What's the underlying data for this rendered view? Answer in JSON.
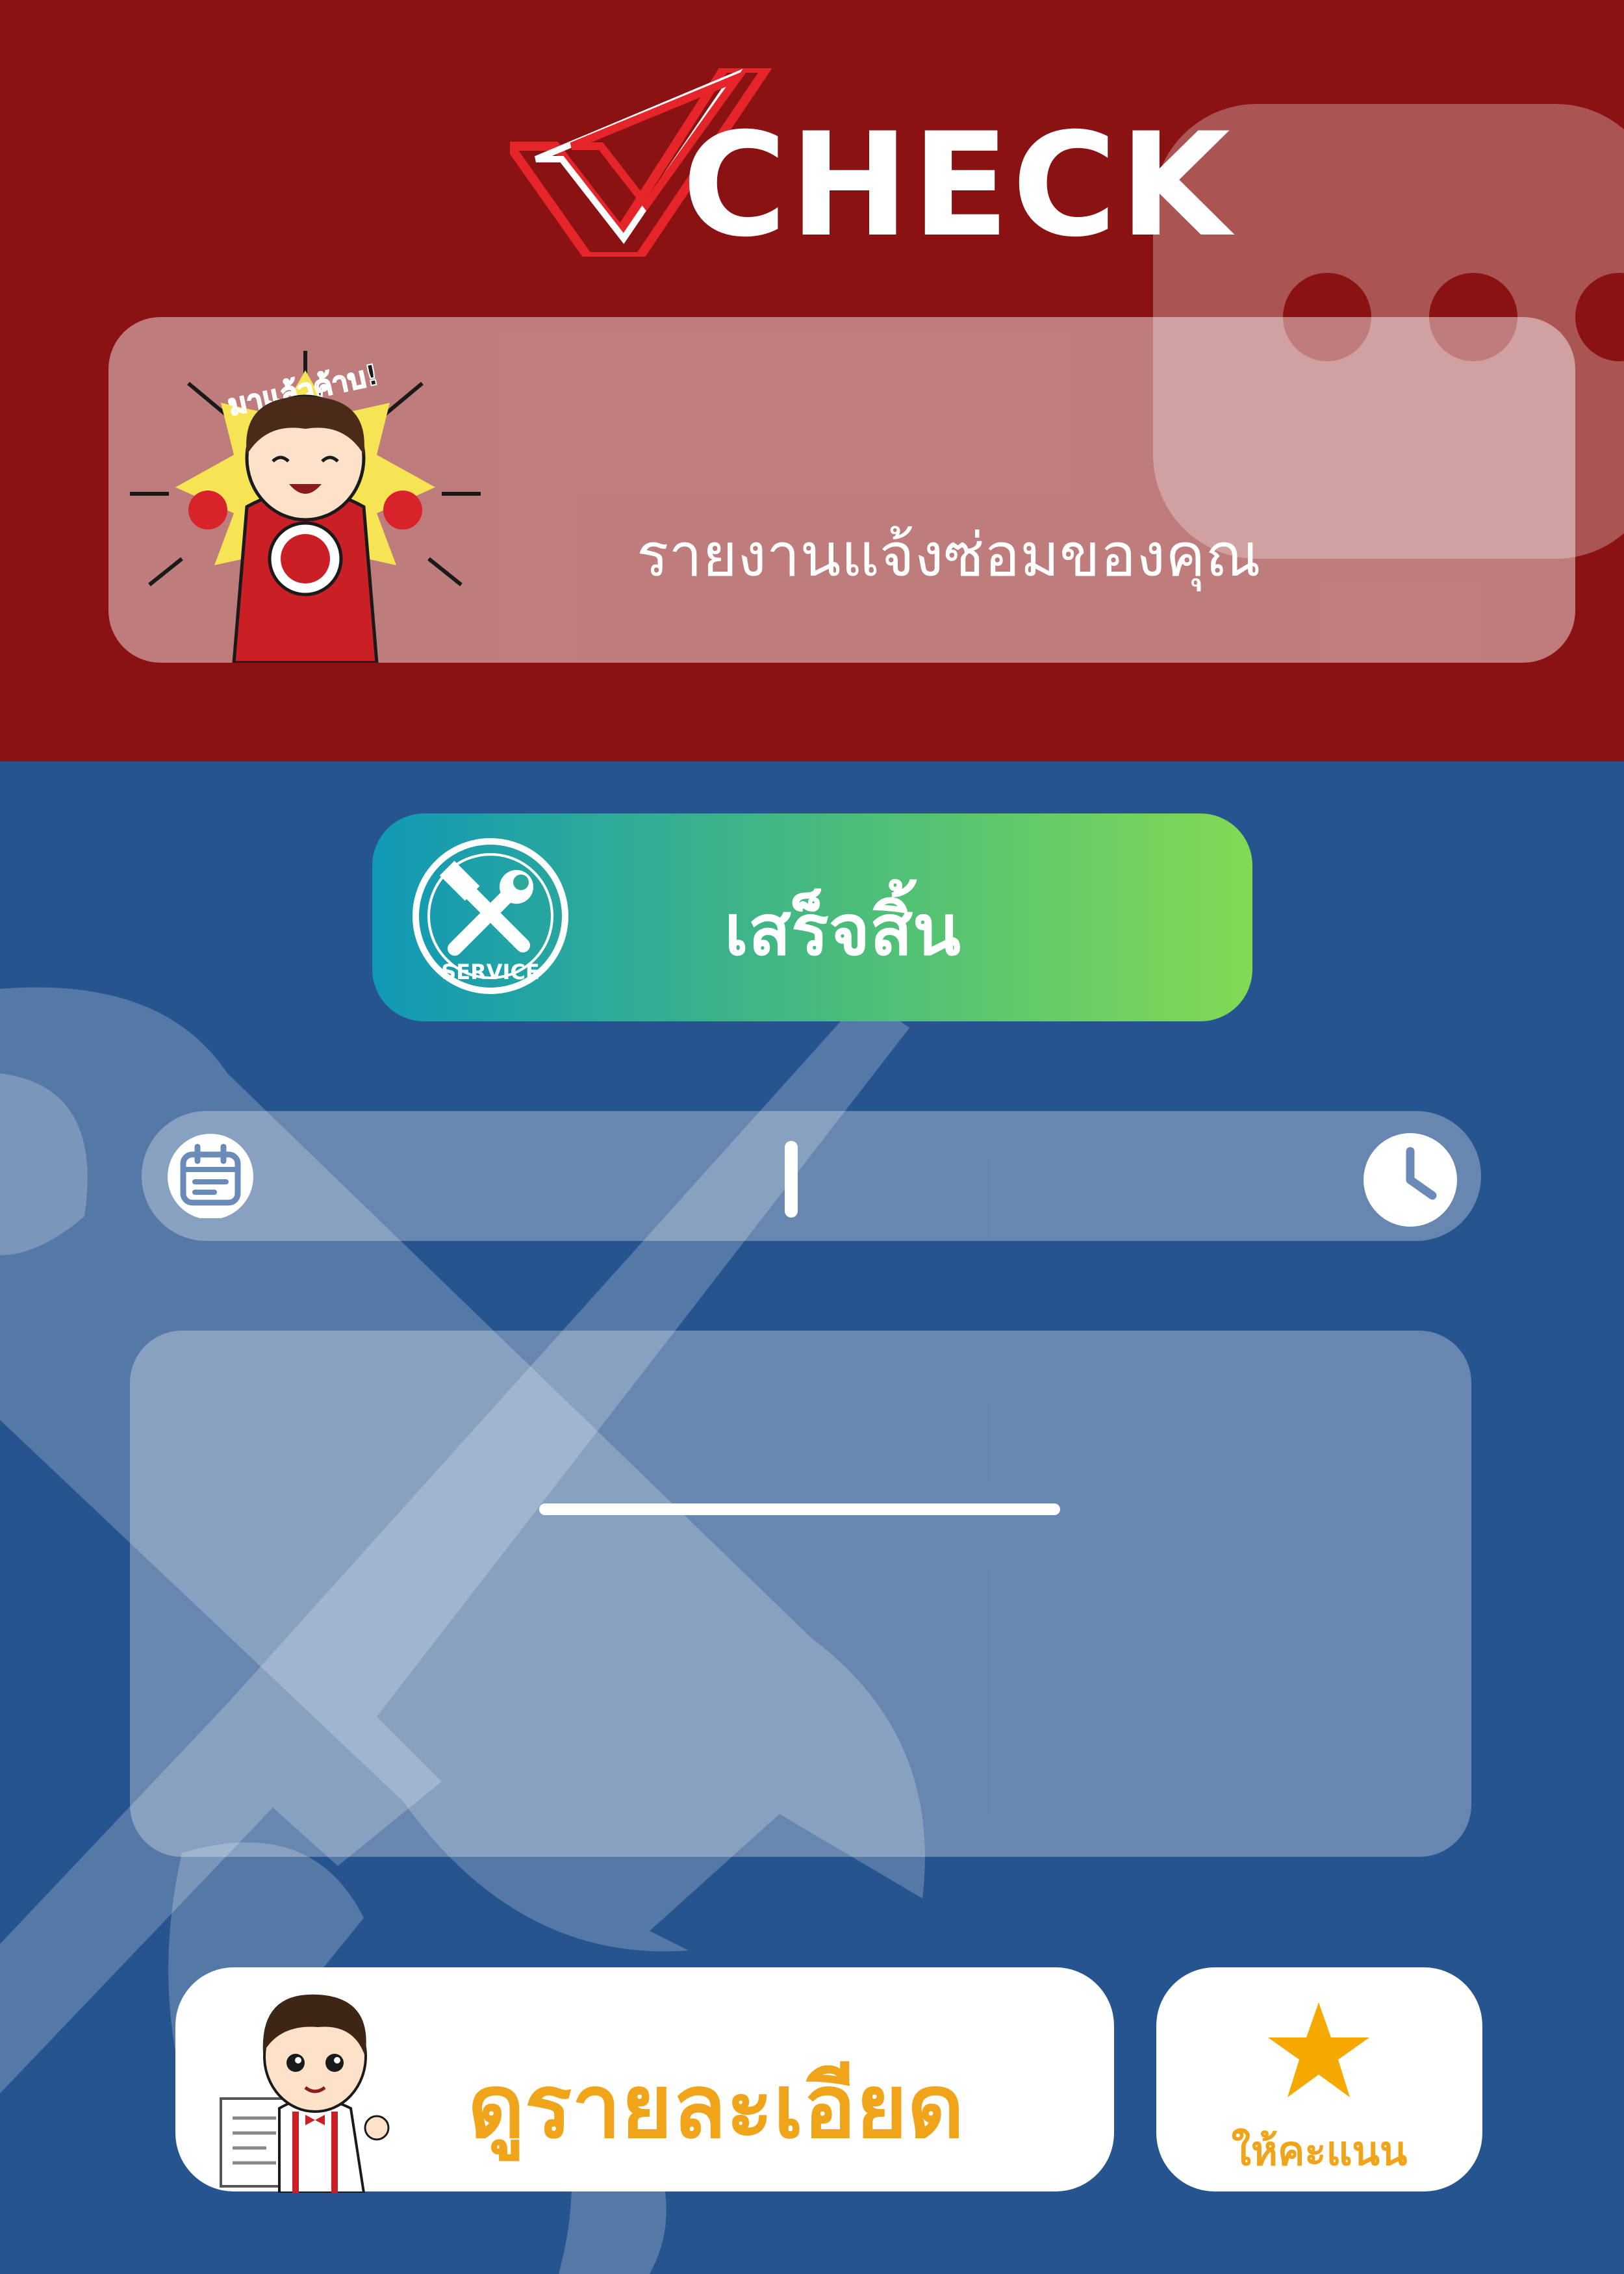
{
  "header": {
    "logo_text": "CHECK",
    "banner_title": "รายงานแจ้งซ่อมของคุณ",
    "mascot_caption": "มาแล้วค้าบ!"
  },
  "status": {
    "icon_label": "SERVICE",
    "label": "เสร็จสิ้น"
  },
  "schedule": {
    "date_value": "",
    "time_value": ""
  },
  "content": {
    "body_text": ""
  },
  "actions": {
    "details_label": "ดูรายละเอียด",
    "rate_label": "ให้คะแนน"
  },
  "colors": {
    "header_bg": "#8b1213",
    "body_bg": "#26548f",
    "accent": "#f0a41a",
    "status_gradient_start": "#1198b6",
    "status_gradient_end": "#82da54"
  }
}
